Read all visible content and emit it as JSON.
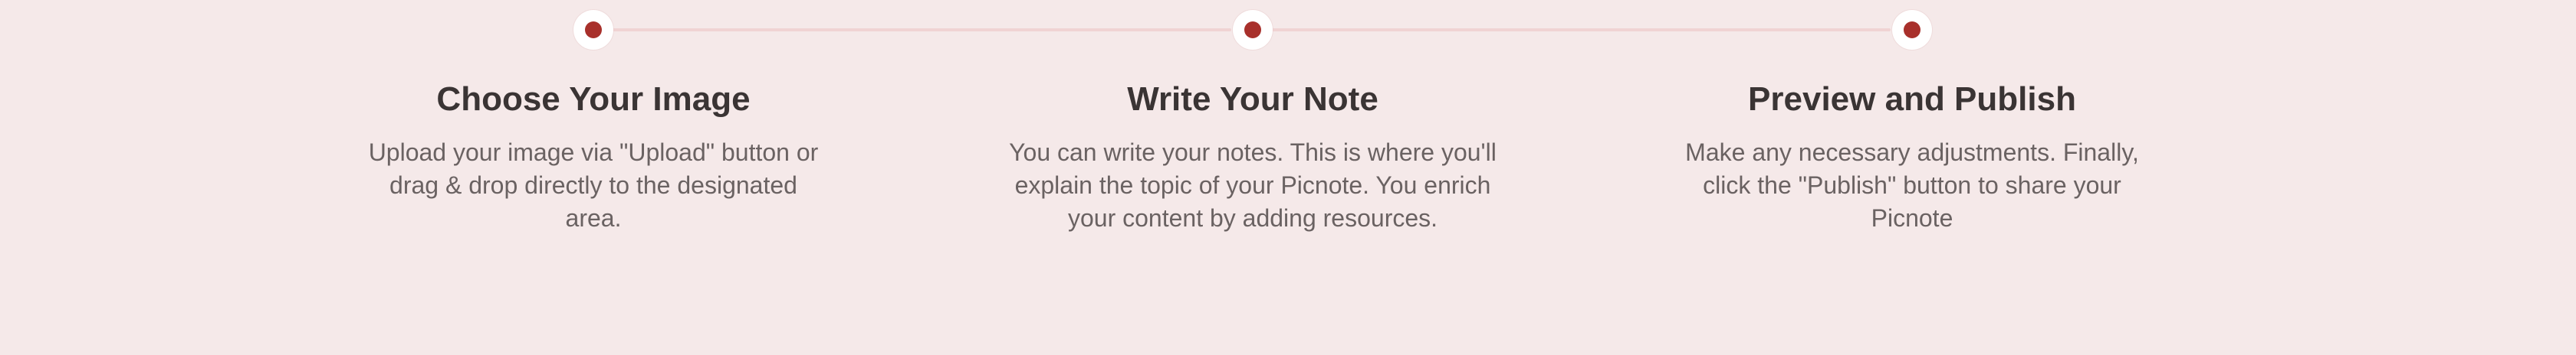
{
  "steps": [
    {
      "title": "Choose Your Image",
      "description_lines": [
        "Upload your image via \"Upload\" button or",
        "drag & drop directly to the designated",
        "area."
      ]
    },
    {
      "title": "Write Your Note",
      "description_lines": [
        "You can write your notes. This is where you'll",
        "explain the topic of your Picnote. You enrich",
        "your content by adding resources."
      ]
    },
    {
      "title": "Preview and Publish",
      "description_lines": [
        "Make any necessary adjustments. Finally,",
        "click the \"Publish\" button to share your",
        "Picnote"
      ]
    }
  ],
  "colors": {
    "background": "#f5e9e9",
    "accent_dot": "#a8302b",
    "connector": "#f0d3d3",
    "title_text": "#3a3434",
    "body_text": "#6a6262"
  }
}
